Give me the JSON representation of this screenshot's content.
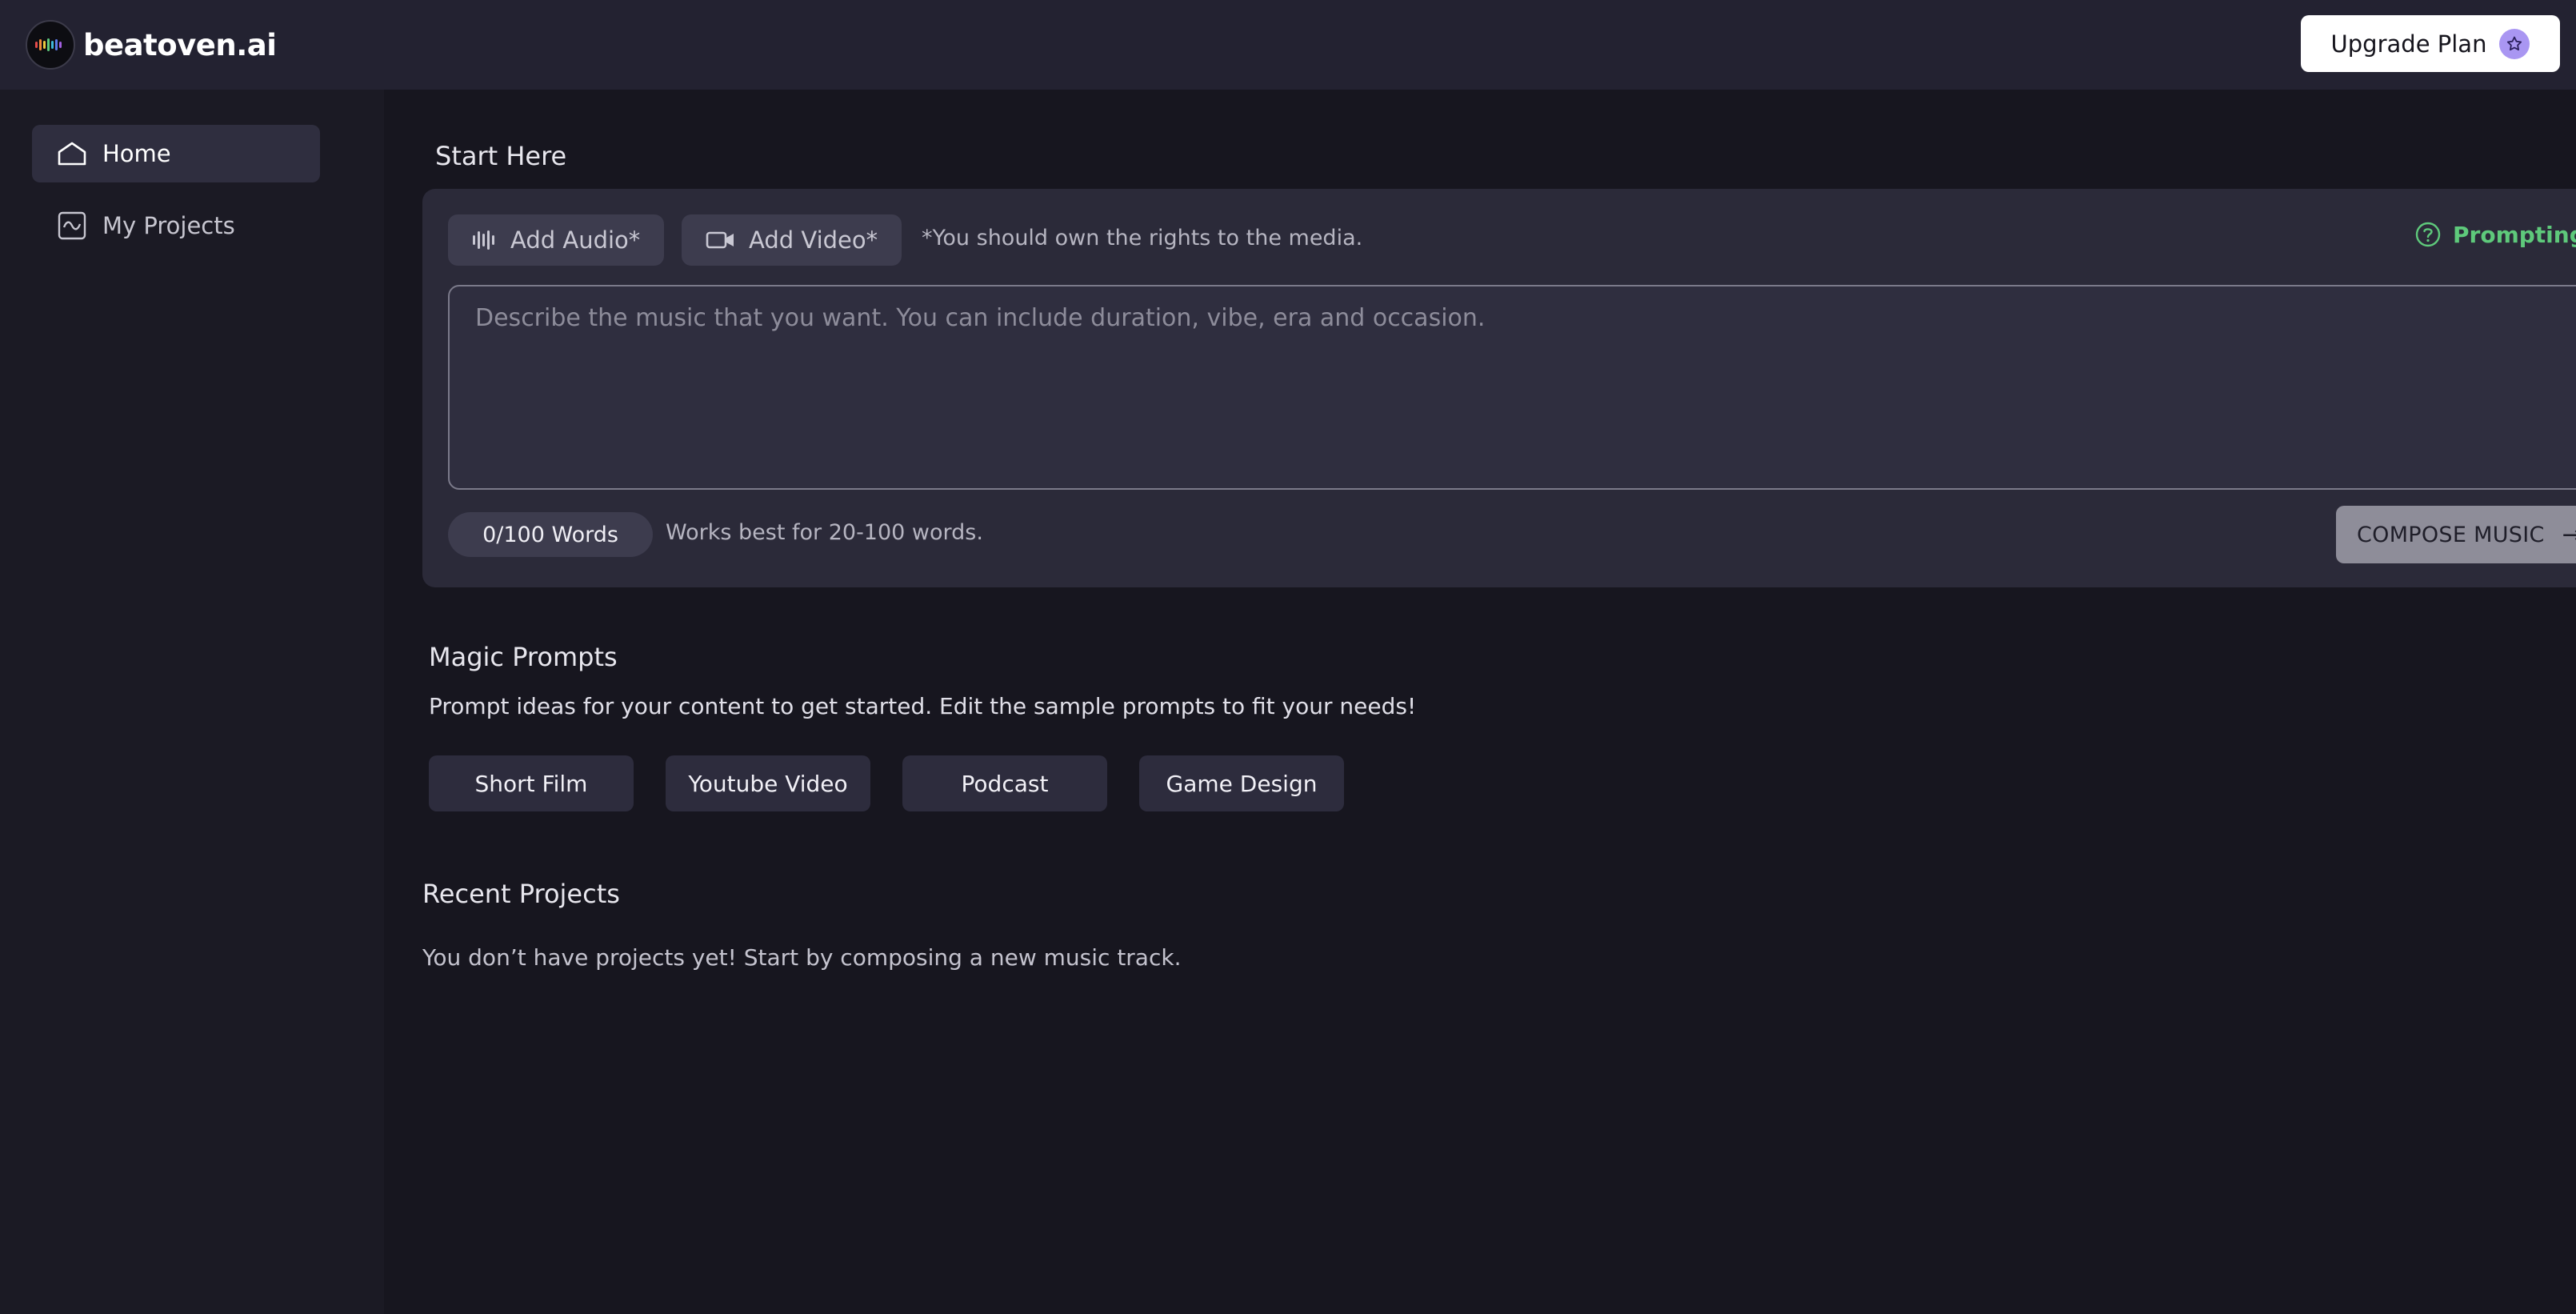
{
  "app": {
    "brand": "beatoven.ai",
    "upgrade_label": "Upgrade Plan"
  },
  "sidebar": {
    "items": [
      {
        "label": "Home",
        "icon": "home-icon",
        "active": true
      },
      {
        "label": "My Projects",
        "icon": "waveform-box-icon",
        "active": false
      }
    ]
  },
  "start": {
    "title": "Start Here",
    "add_audio_label": "Add Audio*",
    "add_video_label": "Add Video*",
    "rights_note": "*You should own the rights to the media.",
    "prompting_tips_label": "Prompting T",
    "prompt_placeholder": "Describe the music that you want. You can include duration, vibe, era and occasion.",
    "prompt_value": "",
    "word_count": "0/100 Words",
    "word_hint": "Works best for 20-100 words.",
    "compose_label": "COMPOSE MUSIC"
  },
  "magic": {
    "title": "Magic Prompts",
    "description": "Prompt ideas for your content to get started. Edit the sample prompts to fit your needs!",
    "chips": [
      "Short Film",
      "Youtube Video",
      "Podcast",
      "Game Design"
    ]
  },
  "recent": {
    "title": "Recent Projects",
    "empty_text": "You don’t have projects yet! Start by composing a new music track."
  },
  "colors": {
    "background": "#17161f",
    "topbar": "#232231",
    "sidebar": "#1b1a24",
    "panel": "#2b2a39",
    "accent_green": "#5ec97b",
    "accent_purple": "#a996f2"
  }
}
